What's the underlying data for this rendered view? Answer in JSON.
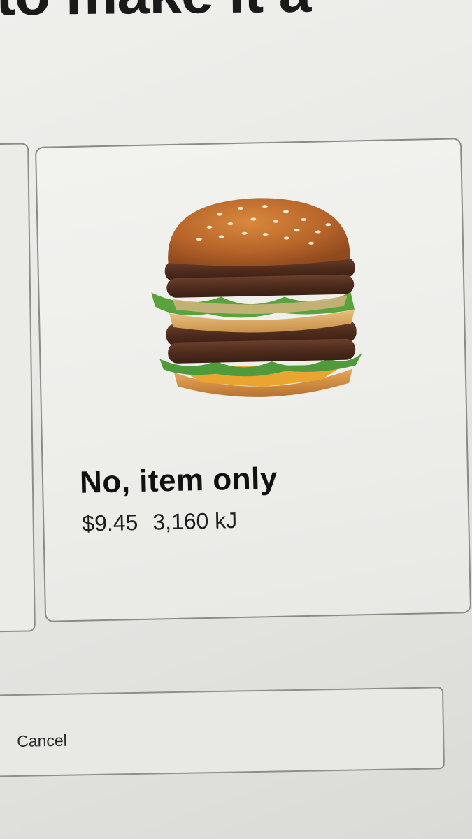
{
  "screen": {
    "heading_partial": "to make it a"
  },
  "option": {
    "title": "No, item only",
    "price": "$9.45",
    "energy": "3,160 kJ",
    "image_icon": "burger-image"
  },
  "footer": {
    "cancel_label": "Cancel"
  },
  "colors": {
    "background": "#e6e6e3",
    "card_border": "#8a8a86",
    "text_primary": "#111111"
  }
}
